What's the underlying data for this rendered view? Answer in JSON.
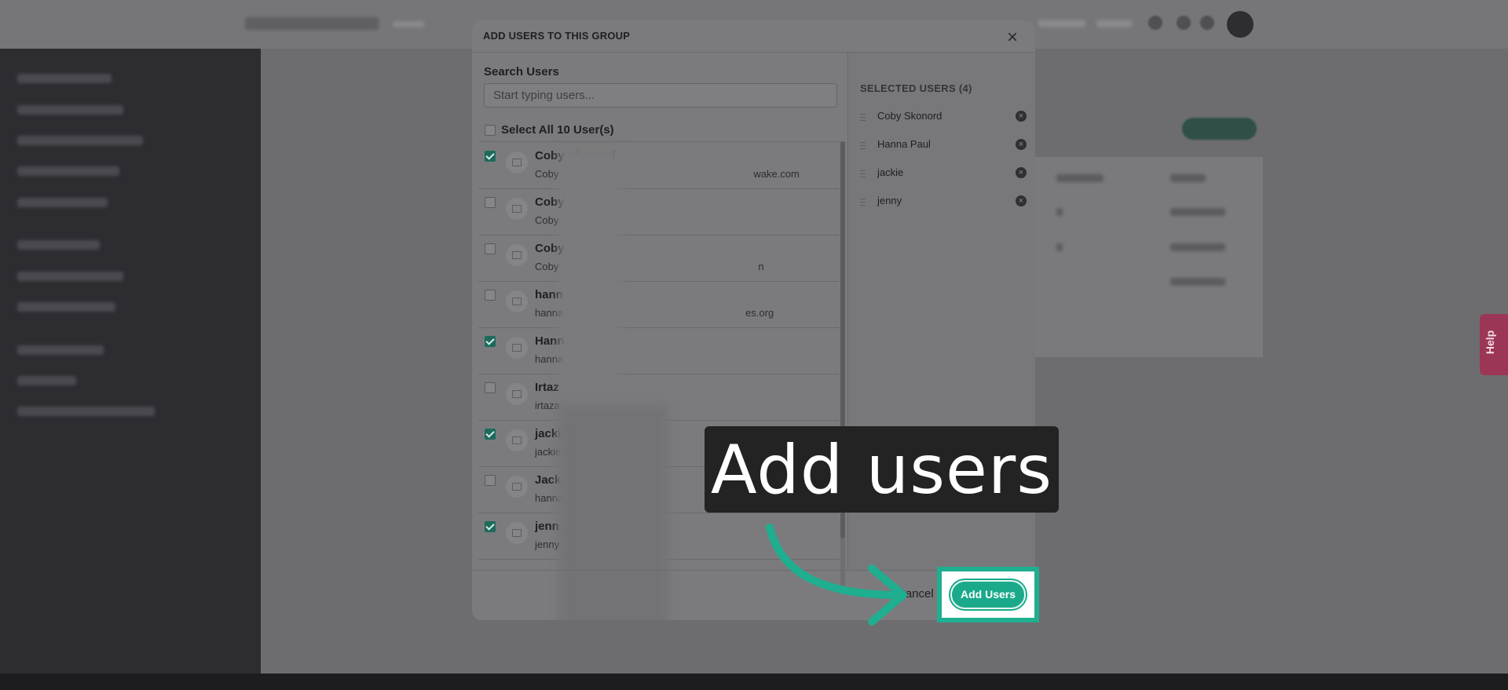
{
  "modal": {
    "title": "ADD USERS TO THIS GROUP",
    "close_icon": "×",
    "search_label": "Search Users",
    "search_placeholder": "Start typing users...",
    "select_all_label": "Select All 10 User(s)",
    "users": [
      {
        "name": "Coby Skonord",
        "email_visible": "Coby",
        "email_suffix": "wake.com",
        "checked": true
      },
      {
        "name": "Coby",
        "email_visible": "Coby",
        "email_suffix": "",
        "checked": false
      },
      {
        "name": "Coby",
        "email_visible": "Coby",
        "email_suffix": "n",
        "checked": false
      },
      {
        "name": "hann",
        "email_visible": "hanna",
        "email_suffix": "es.org",
        "checked": false
      },
      {
        "name": "Hann",
        "email_visible": "hanna",
        "email_suffix": "",
        "checked": true
      },
      {
        "name": "Irtaz",
        "email_visible": "irtaza",
        "email_suffix": "",
        "checked": false
      },
      {
        "name": "jacki",
        "email_visible": "jackie",
        "email_suffix": "",
        "checked": true
      },
      {
        "name": "Jack",
        "email_visible": "hanna",
        "email_suffix": "",
        "checked": false
      },
      {
        "name": "jenn",
        "email_visible": "jenny",
        "email_suffix": "",
        "checked": true
      }
    ],
    "selected_title": "SELECTED USERS (4)",
    "selected": [
      "Coby Skonord",
      "Hanna Paul",
      "jackie",
      "jenny"
    ],
    "remove_icon": "×",
    "cancel_label": "Cancel",
    "add_label": "Add Users"
  },
  "help_tab": "Help",
  "tutorial": {
    "caption": "Add users",
    "arrow_color": "#1fae8f"
  },
  "colors": {
    "accent": "#1aaa8b",
    "highlight_border": "#1fae8f"
  }
}
